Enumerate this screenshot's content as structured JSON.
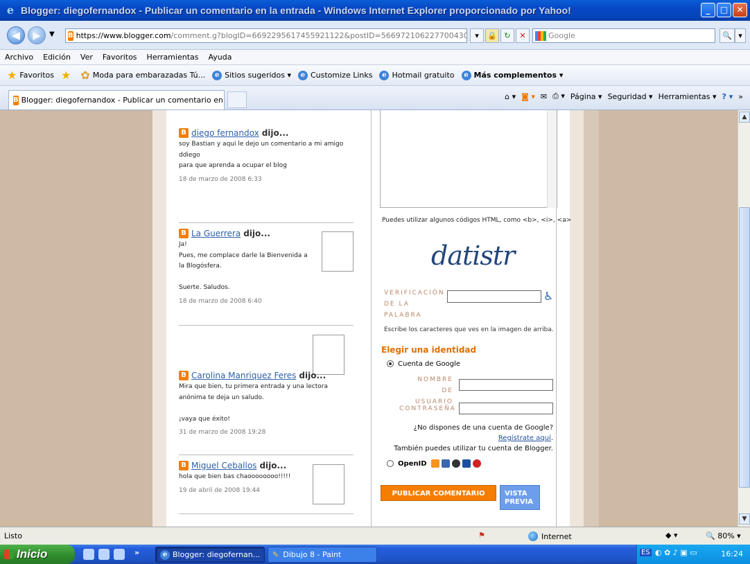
{
  "window": {
    "title": "Blogger: diegofernandox - Publicar un comentario en la entrada - Windows Internet Explorer proporcionado por Yahoo!",
    "min": "_",
    "max": "□",
    "close": "✕"
  },
  "address": {
    "url_host": "https://www.blogger.com",
    "url_rest": "/comment.g?blogID=6692295617455921122&postID=5669721062277004305",
    "search_placeholder": "Google"
  },
  "menu": [
    "Archivo",
    "Edición",
    "Ver",
    "Favoritos",
    "Herramientas",
    "Ayuda"
  ],
  "favorites": {
    "label": "Favoritos",
    "links": [
      "Moda para embarazadas Tú...",
      "Sitios sugeridos ▾",
      "Customize Links",
      "Hotmail gratuito",
      "Más complementos ▾"
    ]
  },
  "tabs": {
    "active": "Blogger: diegofernandox - Publicar un comentario en l...",
    "commands": [
      "Página ▾",
      "Seguridad ▾",
      "Herramientas ▾"
    ]
  },
  "comments": [
    {
      "author": "diego fernandox",
      "said": "dijo...",
      "lines": [
        "soy Bastian y aqui le dejo un comentario a mi amigo",
        "ddiego",
        "para que aprenda a ocupar el blog"
      ],
      "date": "18 de marzo de 2008 6:33"
    },
    {
      "author": "La Guerrera",
      "said": "dijo...",
      "lines": [
        "Ja!",
        "Pues, me complace darle la Bienvenida a",
        "la Blogósfera.",
        "",
        "Suerte. Saludos."
      ],
      "date": "18 de marzo de 2008 6:40"
    },
    {
      "author": "Carolina Manriquez Feres",
      "said": "dijo...",
      "lines": [
        "Mira que bien, tu primera entrada y una lectora",
        "anónima te deja un saludo.",
        "",
        "¡vaya que éxito!"
      ],
      "date": "31 de marzo de 2008 19:28"
    },
    {
      "author": "Miguel Ceballos",
      "said": "dijo...",
      "lines": [
        "hola que bien bas chaoooooooo!!!!!"
      ],
      "date": "19 de abril de 2008 19:44"
    }
  ],
  "form": {
    "html_hint": "Puedes utilizar algunos códigos HTML, como <b>, <i>, <a>",
    "captcha_word": "datistr",
    "verify_label": "VERIFICACIÓN DE LA PALABRA",
    "verify_hint": "Escribe los caracteres que ves en la imagen de arriba.",
    "identity_title": "Elegir una identidad",
    "google_option": "Cuenta de Google",
    "username_label": "NOMBRE DE USUARIO",
    "password_label": "CONTRASEÑA",
    "no_account": "¿No dispones de una cuenta de Google?",
    "register": "Regístrate aquí",
    "blogger_account": "También puedes utilizar tu cuenta de Blogger.",
    "openid_option": "OpenID",
    "publish_button": "PUBLICAR COMENTARIO",
    "preview_button": "VISTA PREVIA"
  },
  "status": {
    "text": "Listo",
    "zone": "Internet",
    "zoom": "80%"
  },
  "taskbar": {
    "start": "Inicio",
    "tasks": [
      "Blogger: diegofernan...",
      "Dibujo 8 - Paint"
    ],
    "lang": "ES",
    "clock": "16:24"
  },
  "colors": {
    "orange": "#f57d00",
    "link": "#2c5fa8",
    "label": "#b8876a",
    "background": "#cdb9a4"
  }
}
